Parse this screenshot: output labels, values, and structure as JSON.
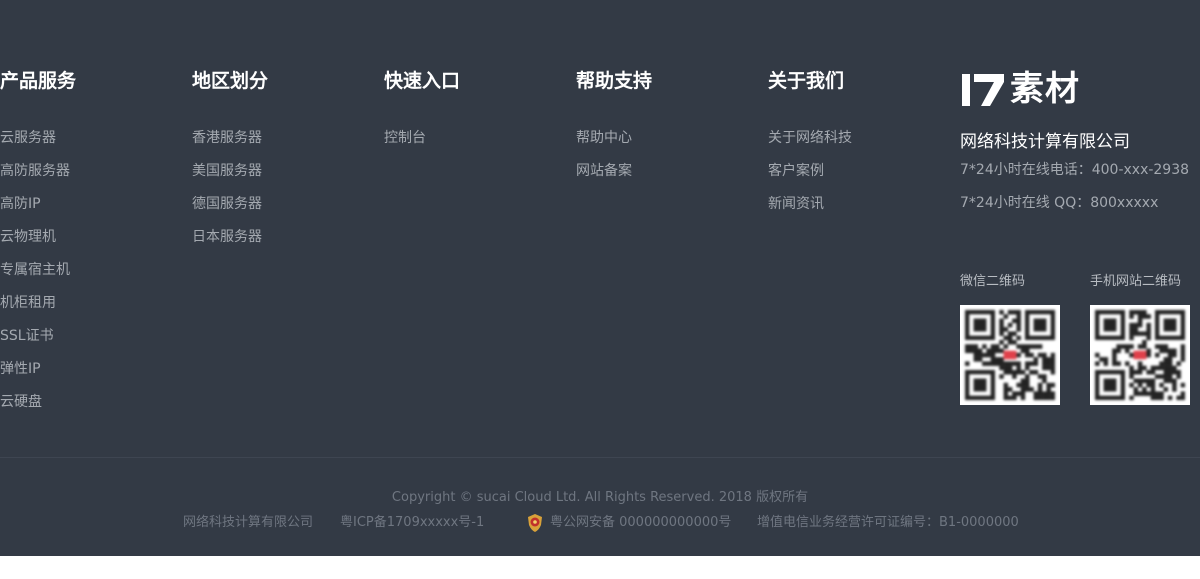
{
  "columns": [
    {
      "title": "产品服务",
      "items": [
        "云服务器",
        "高防服务器",
        "高防IP",
        "云物理机",
        "专属宿主机",
        "机柜租用",
        "SSL证书",
        "弹性IP",
        "云硬盘"
      ]
    },
    {
      "title": "地区划分",
      "items": [
        "香港服务器",
        "美国服务器",
        "德国服务器",
        "日本服务器"
      ]
    },
    {
      "title": "快速入口",
      "items": [
        "控制台"
      ]
    },
    {
      "title": "帮助支持",
      "items": [
        "帮助中心",
        "网站备案"
      ]
    },
    {
      "title": "关于我们",
      "items": [
        "关于网络科技",
        "客户案例",
        "新闻资讯"
      ]
    }
  ],
  "brand": {
    "logo_mark": "17",
    "logo_text": "素材",
    "company_name": "网络科技计算有限公司",
    "phone": "7*24小时在线电话：400-xxx-2938",
    "qq": "7*24小时在线 QQ：800xxxxx"
  },
  "qr": {
    "wechat_label": "微信二维码",
    "mobile_label": "手机网站二维码"
  },
  "bottom": {
    "copyright": "Copyright © sucai Cloud Ltd. All Rights Reserved. 2018 版权所有",
    "company": "网络科技计算有限公司",
    "icp": "粤ICP备1709xxxxx号-1",
    "police": "粤公网安备 000000000000号",
    "license": "增值电信业务经营许可证编号：B1-0000000"
  },
  "colors": {
    "background": "#333a45",
    "title": "#ffffff",
    "link": "#a4a9b0",
    "muted": "#6f7681"
  }
}
